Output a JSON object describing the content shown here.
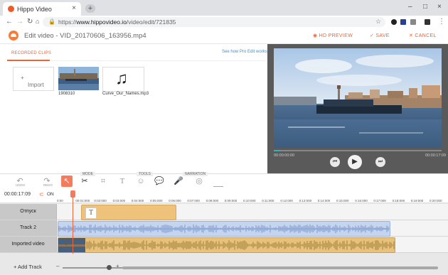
{
  "browser": {
    "tab_title": "Hippo Video",
    "close_tab": "×",
    "new_tab": "+",
    "url_domain": "www.hippovideo.io",
    "url_path": "/video/edit/721835",
    "url_scheme": "https://",
    "window_min": "–",
    "window_max": "□",
    "window_close": "×"
  },
  "header": {
    "title": "Edit video - VID_20170606_163956.mp4",
    "hd_preview": "HD PREVIEW",
    "save": "SAVE",
    "cancel": "CANCEL"
  },
  "clips": {
    "tab_label": "RECORDED CLIPS",
    "pro_link": "See how Pro Edit works",
    "import_label": "Import",
    "items": [
      {
        "label": "1908310"
      },
      {
        "label": "Curve_Our_Names.mp3"
      }
    ]
  },
  "player": {
    "time_start": "00:00:00:00",
    "time_end": "00:00:17:09",
    "progress": 0.04
  },
  "toolbar": {
    "undo": "UNDO",
    "redo": "REDO",
    "mode_label": "MODE",
    "tools_label": "TOOLS",
    "narration_label": "NARRATION"
  },
  "timeline": {
    "timecode": "00:00:17:09",
    "magnet_label": "ON",
    "ticks": [
      "0:00",
      "00:01:000",
      "0:02:000",
      "0:03:000",
      "0:04:000",
      "0:05:000",
      "0:06:000",
      "0:07:000",
      "0:08:000",
      "0:09:000",
      "0:10:000",
      "0:11:000",
      "0:12:000",
      "0:13:000",
      "0:14:000",
      "0:15:000",
      "0:16:000",
      "0:17:000",
      "0:18:000",
      "0:19:000",
      "0:20:000"
    ],
    "tracks": [
      {
        "name": "Отпуск"
      },
      {
        "name": "Track 2"
      },
      {
        "name": "Imported video"
      }
    ],
    "add_track": "+ Add Track"
  },
  "colors": {
    "accent": "#e5673a",
    "text_clip": "#f0c070",
    "audio_clip": "#c7d6ee",
    "video_clip": "#e9c47a"
  }
}
